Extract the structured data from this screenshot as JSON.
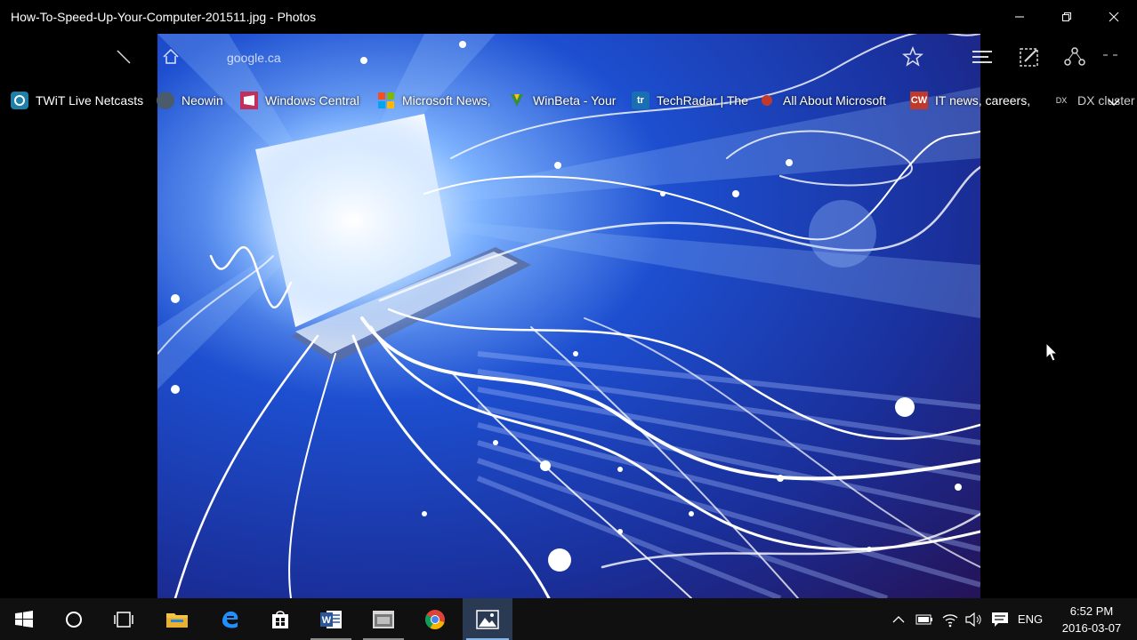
{
  "window": {
    "title": "How-To-Speed-Up-Your-Computer-201511.jpg - Photos",
    "buttons": [
      "minimize",
      "maximize",
      "close"
    ]
  },
  "browser_overlay": {
    "address_text": "google.ca"
  },
  "favorites": [
    {
      "label": "TWiT Live Netcasts",
      "icon": "twit-icon",
      "color": "#1e7fa8"
    },
    {
      "label": "Neowin",
      "icon": "neowin-icon",
      "color": "#4a5b6b"
    },
    {
      "label": "Windows Central",
      "icon": "windows-central-icon",
      "color": "#c0305a"
    },
    {
      "label": "Microsoft News,",
      "icon": "microsoft-news-icon",
      "color": "#333333"
    },
    {
      "label": "WinBeta - Your",
      "icon": "winbeta-icon",
      "color": "#3a8c3a"
    },
    {
      "label": "TechRadar | The",
      "icon": "techradar-icon",
      "color": "#1a6fb0"
    },
    {
      "label": "All About Microsoft",
      "icon": "all-about-microsoft-icon",
      "color": "#c0392b"
    },
    {
      "label": "IT news, careers,",
      "icon": "computerworld-icon",
      "color": "#c0392b"
    },
    {
      "label": "DX cluster",
      "icon": "dx-icon",
      "color": "#333333"
    }
  ],
  "fav_icon_text": {
    "techradar": "tr",
    "computerworld": "CW",
    "dx": "DX"
  },
  "taskbar": {
    "apps": [
      "start-button",
      "cortana-search",
      "task-view",
      "file-explorer",
      "edge",
      "store",
      "word",
      "snipping-app",
      "chrome",
      "photos"
    ],
    "language": "ENG",
    "time": "6:52 PM",
    "date": "2016-03-07"
  },
  "colors": {
    "taskbar_bg": "#101010",
    "accent": "#86b7e8",
    "photo_blue": "#1d4fd0"
  }
}
